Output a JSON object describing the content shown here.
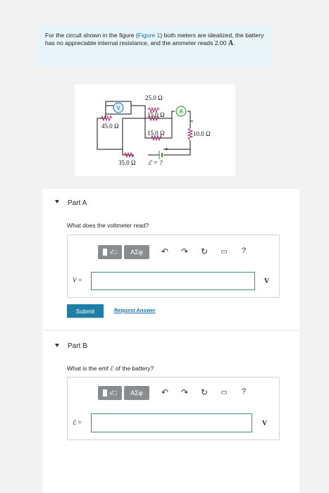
{
  "problem": {
    "text_before_link": "For the circuit shown in the figure (",
    "link": "Figure 1",
    "text_after_link": ") both meters are idealized, the battery has no appreciable internal resistance, and the ammeter reads 2.00 ",
    "unit": "A",
    "end": "."
  },
  "figure": {
    "r_top": "25.0 Ω",
    "r_mid": "15.0 Ω",
    "r_left": "45.0 Ω",
    "r_lower": "15.0 Ω",
    "r_right": "10.0 Ω",
    "r_bottom": "35.0 Ω",
    "emf_label": "ℰ = ?",
    "voltmeter": "V",
    "ammeter": "A"
  },
  "partA": {
    "title": "Part A",
    "question": "What does the voltmeter read?",
    "var_label": "V =",
    "unit": "V",
    "toolbar": {
      "matrix_icon": "template-icon",
      "greek": "ΑΣφ",
      "help": "?"
    },
    "input_value": "",
    "submit_label": "Submit",
    "request_label": "Request Answer"
  },
  "partB": {
    "title": "Part B",
    "question": "What is the emf ℰ of the battery?",
    "var_label": "ℰ =",
    "unit": "V",
    "toolbar": {
      "matrix_icon": "template-icon",
      "greek": "ΑΣφ",
      "help": "?"
    },
    "input_value": ""
  },
  "colors": {
    "accent": "#1e7fa6",
    "problem_bg": "#e8f4f8",
    "resistor": "#b0266e"
  }
}
